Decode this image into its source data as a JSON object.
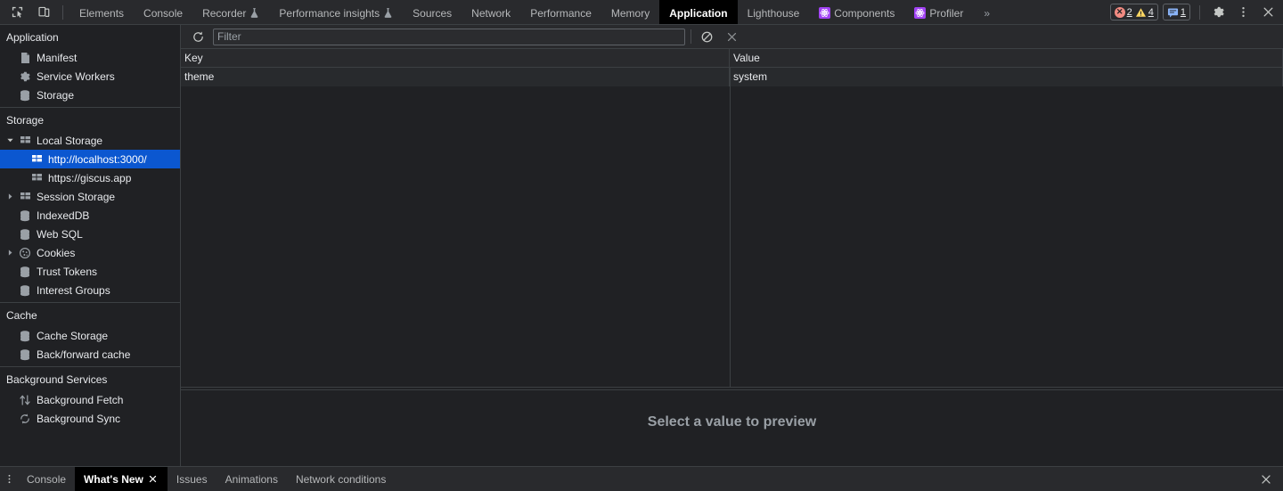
{
  "topbar": {
    "left_icons": [
      {
        "name": "inspect-element-icon",
        "title": "Inspect element"
      },
      {
        "name": "device-toolbar-icon",
        "title": "Toggle device toolbar"
      }
    ],
    "tabs": [
      {
        "label": "Elements",
        "active": false,
        "experimental": false,
        "extension": false
      },
      {
        "label": "Console",
        "active": false,
        "experimental": false,
        "extension": false
      },
      {
        "label": "Recorder",
        "active": false,
        "experimental": true,
        "extension": false
      },
      {
        "label": "Performance insights",
        "active": false,
        "experimental": true,
        "extension": false
      },
      {
        "label": "Sources",
        "active": false,
        "experimental": false,
        "extension": false
      },
      {
        "label": "Network",
        "active": false,
        "experimental": false,
        "extension": false
      },
      {
        "label": "Performance",
        "active": false,
        "experimental": false,
        "extension": false
      },
      {
        "label": "Memory",
        "active": false,
        "experimental": false,
        "extension": false
      },
      {
        "label": "Application",
        "active": true,
        "experimental": false,
        "extension": false
      },
      {
        "label": "Lighthouse",
        "active": false,
        "experimental": false,
        "extension": false
      },
      {
        "label": "Components",
        "active": false,
        "experimental": false,
        "extension": true
      },
      {
        "label": "Profiler",
        "active": false,
        "experimental": false,
        "extension": true
      }
    ],
    "overflow_label": "»",
    "error_count": "2",
    "warning_count": "4",
    "message_count": "1",
    "settings_title": "Settings",
    "more_title": "Customize and control DevTools",
    "close_title": "Close DevTools"
  },
  "sidebar": {
    "sections": [
      {
        "title": "Application",
        "items": [
          {
            "label": "Manifest",
            "icon": "manifest-document-icon",
            "indent": 1,
            "twisty": "none",
            "selected": false
          },
          {
            "label": "Service Workers",
            "icon": "gear-icon",
            "indent": 1,
            "twisty": "none",
            "selected": false
          },
          {
            "label": "Storage",
            "icon": "database-icon",
            "indent": 1,
            "twisty": "none",
            "selected": false
          }
        ]
      },
      {
        "title": "Storage",
        "items": [
          {
            "label": "Local Storage",
            "icon": "table-icon",
            "indent": 1,
            "twisty": "expanded",
            "selected": false
          },
          {
            "label": "http://localhost:3000/",
            "icon": "table-icon",
            "indent": 2,
            "twisty": "none",
            "selected": true
          },
          {
            "label": "https://giscus.app",
            "icon": "table-icon",
            "indent": 2,
            "twisty": "none",
            "selected": false
          },
          {
            "label": "Session Storage",
            "icon": "table-icon",
            "indent": 1,
            "twisty": "collapsed",
            "selected": false
          },
          {
            "label": "IndexedDB",
            "icon": "database-icon",
            "indent": 1,
            "twisty": "none",
            "selected": false
          },
          {
            "label": "Web SQL",
            "icon": "database-icon",
            "indent": 1,
            "twisty": "none",
            "selected": false
          },
          {
            "label": "Cookies",
            "icon": "cookie-icon",
            "indent": 1,
            "twisty": "collapsed",
            "selected": false
          },
          {
            "label": "Trust Tokens",
            "icon": "database-icon",
            "indent": 1,
            "twisty": "none",
            "selected": false
          },
          {
            "label": "Interest Groups",
            "icon": "database-icon",
            "indent": 1,
            "twisty": "none",
            "selected": false
          }
        ]
      },
      {
        "title": "Cache",
        "items": [
          {
            "label": "Cache Storage",
            "icon": "database-icon",
            "indent": 1,
            "twisty": "none",
            "selected": false
          },
          {
            "label": "Back/forward cache",
            "icon": "database-icon",
            "indent": 1,
            "twisty": "none",
            "selected": false
          }
        ]
      },
      {
        "title": "Background Services",
        "items": [
          {
            "label": "Background Fetch",
            "icon": "background-fetch-icon",
            "indent": 1,
            "twisty": "none",
            "selected": false
          },
          {
            "label": "Background Sync",
            "icon": "background-sync-icon",
            "indent": 1,
            "twisty": "none",
            "selected": false
          }
        ]
      }
    ]
  },
  "panel": {
    "toolbar": {
      "refresh_title": "Refresh",
      "filter_placeholder": "Filter",
      "filter_value": "",
      "clear_all_title": "Clear all",
      "delete_selected_title": "Delete Selected"
    },
    "table": {
      "columns": [
        "Key",
        "Value"
      ],
      "rows": [
        {
          "key": "theme",
          "value": "system"
        }
      ]
    },
    "preview_placeholder": "Select a value to preview"
  },
  "drawer": {
    "more_title": "More tools",
    "tabs": [
      {
        "label": "Console",
        "active": false,
        "closable": false
      },
      {
        "label": "What's New",
        "active": true,
        "closable": true
      },
      {
        "label": "Issues",
        "active": false,
        "closable": false
      },
      {
        "label": "Animations",
        "active": false,
        "closable": false
      },
      {
        "label": "Network conditions",
        "active": false,
        "closable": false
      }
    ],
    "close_title": "Close drawer"
  },
  "colors": {
    "background": "#202124",
    "toolbar": "#292a2d",
    "selection_blue": "#0b57d0",
    "text": "#e8eaed",
    "muted_text": "#9aa0a6",
    "border": "#3c4043",
    "extension_purple": "#a142f4",
    "error_red": "#f28b82",
    "warning_yellow": "#fdd663",
    "info_blue": "#8ab4f8"
  }
}
